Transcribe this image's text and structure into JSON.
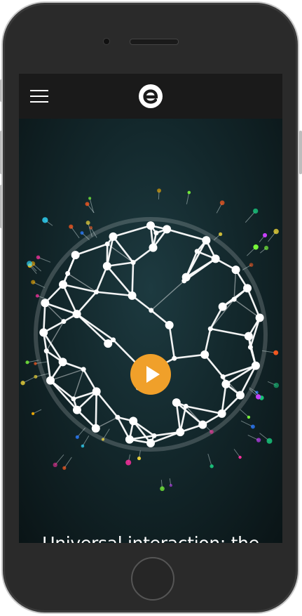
{
  "header": {
    "menu_icon": "hamburger-menu-icon",
    "logo_icon": "e-logo-icon"
  },
  "hero": {
    "media_icon": "play-icon",
    "headline": "Universal interaction: the new S-curve",
    "accent_color": "#f0a02a"
  },
  "device": {
    "home_button_icon": "home-button"
  }
}
